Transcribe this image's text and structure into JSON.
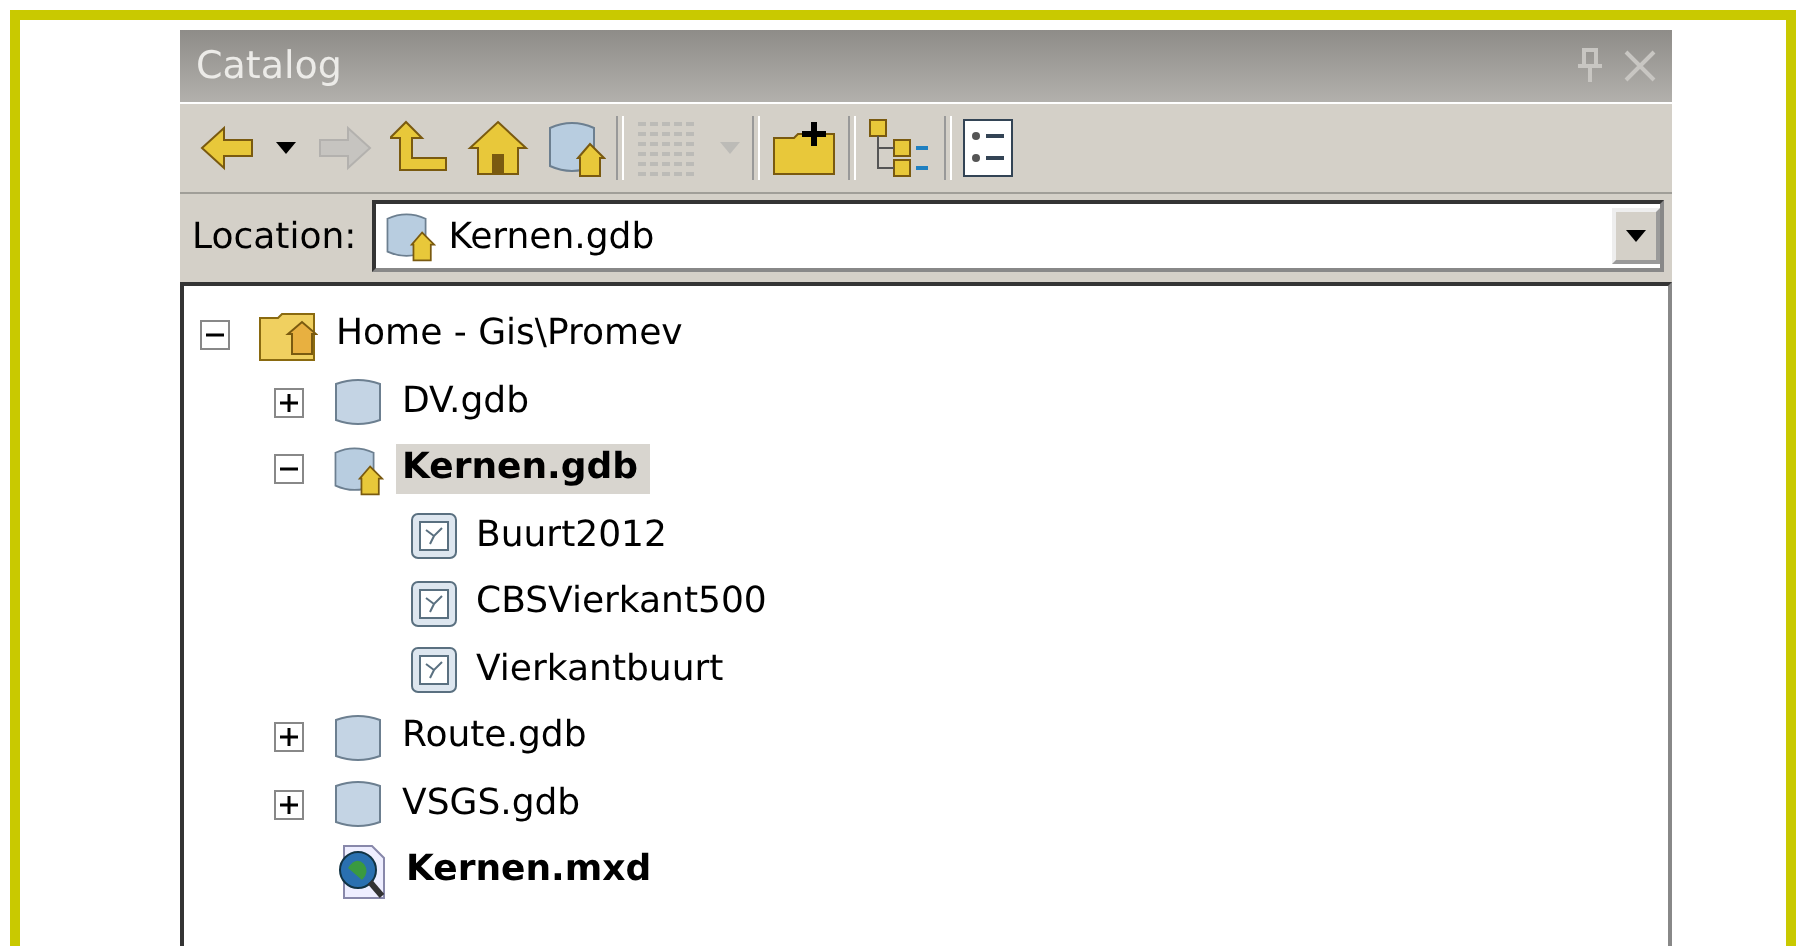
{
  "window": {
    "title": "Catalog"
  },
  "toolbar": [
    {
      "kind": "back",
      "disabled": false
    },
    {
      "kind": "dropdown",
      "disabled": false
    },
    {
      "kind": "forward",
      "disabled": true
    },
    {
      "kind": "up",
      "disabled": false
    },
    {
      "kind": "home",
      "disabled": false
    },
    {
      "kind": "gdb-home",
      "disabled": false
    },
    {
      "kind": "separator"
    },
    {
      "kind": "grid",
      "disabled": true
    },
    {
      "kind": "dropdown",
      "disabled": true
    },
    {
      "kind": "separator"
    },
    {
      "kind": "connect",
      "disabled": false
    },
    {
      "kind": "separator"
    },
    {
      "kind": "tree",
      "disabled": false
    },
    {
      "kind": "separator"
    },
    {
      "kind": "list",
      "disabled": false
    }
  ],
  "location": {
    "label": "Location:",
    "value": "Kernen.gdb"
  },
  "tree": [
    {
      "label": "Home - Gis\\Promev",
      "kind": "home-folder",
      "expanded": true,
      "selected": false,
      "current": false,
      "children": [
        {
          "label": "DV.gdb",
          "kind": "gdb",
          "expanded": false,
          "selected": false,
          "current": false
        },
        {
          "label": "Kernen.gdb",
          "kind": "gdb-home",
          "expanded": true,
          "selected": true,
          "current": true,
          "children": [
            {
              "label": "Buurt2012",
              "kind": "dataset",
              "selected": false,
              "current": false
            },
            {
              "label": "CBSVierkant500",
              "kind": "dataset",
              "selected": false,
              "current": false
            },
            {
              "label": "Vierkantbuurt",
              "kind": "dataset",
              "selected": false,
              "current": false
            }
          ]
        },
        {
          "label": "Route.gdb",
          "kind": "gdb",
          "expanded": false,
          "selected": false,
          "current": false
        },
        {
          "label": "VSGS.gdb",
          "kind": "gdb",
          "expanded": false,
          "selected": false,
          "current": false
        },
        {
          "label": "Kernen.mxd",
          "kind": "mxd",
          "selected": false,
          "current": true
        }
      ]
    }
  ]
}
